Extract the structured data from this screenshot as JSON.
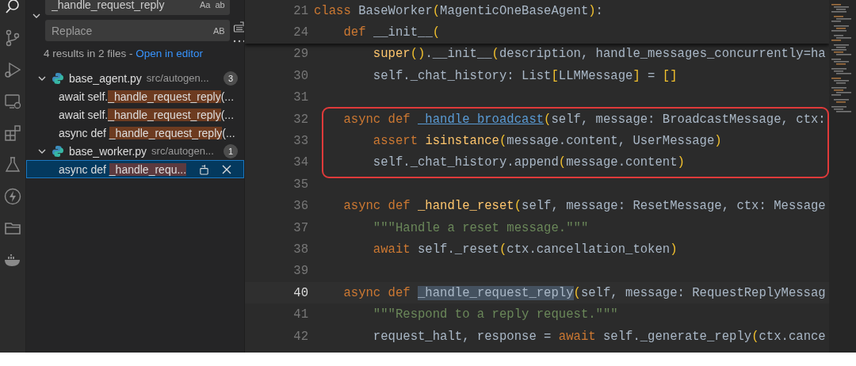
{
  "activity_bar": [
    {
      "kind": "search",
      "selected": true
    },
    {
      "kind": "source-control",
      "selected": false
    },
    {
      "kind": "run-debug",
      "selected": false
    },
    {
      "kind": "remote",
      "selected": false
    },
    {
      "kind": "extensions",
      "selected": false
    },
    {
      "kind": "testing",
      "selected": false
    },
    {
      "kind": "lightning",
      "selected": false
    },
    {
      "kind": "folder",
      "selected": false
    },
    {
      "kind": "docker",
      "selected": false
    }
  ],
  "search": {
    "find_value": "_handle_request_reply",
    "find_options": [
      "Aa",
      "ab"
    ],
    "replace_placeholder": "Replace",
    "replace_option": "AB",
    "summary": "4 results in 2 files - ",
    "open_link": "Open in editor",
    "files": [
      {
        "name": "base_agent.py",
        "path": "src/autogen...",
        "count": "3",
        "expanded": true,
        "matches": [
          {
            "before": "await self.",
            "match": "_handle_request_reply",
            "after": "(...",
            "selected": false
          },
          {
            "before": "await self.",
            "match": "_handle_request_reply",
            "after": "(...",
            "selected": false
          },
          {
            "before": "async def ",
            "match": "_handle_request_reply",
            "after": "(...",
            "selected": false
          }
        ]
      },
      {
        "name": "base_worker.py",
        "path": "src/autogen...",
        "count": "1",
        "expanded": true,
        "matches": [
          {
            "before": "async def ",
            "match": "_handle_requ...",
            "selected": true
          }
        ]
      }
    ]
  },
  "editor": {
    "sticky_lines": [
      {
        "number": "21",
        "tokens": [
          {
            "kind": "keyword",
            "text": "class "
          },
          {
            "kind": "plain",
            "text": "BaseWorker"
          },
          {
            "kind": "bracket",
            "text": "("
          },
          {
            "kind": "plain",
            "text": "MagenticOneBaseAgent"
          },
          {
            "kind": "bracket",
            "text": ")"
          },
          {
            "kind": "plain",
            "text": ":"
          }
        ]
      },
      {
        "number": "24",
        "tokens": [
          {
            "kind": "keyword",
            "text": "    def "
          },
          {
            "kind": "plain",
            "text": "__init__"
          },
          {
            "kind": "bracket",
            "text": "("
          }
        ]
      }
    ],
    "lines": [
      {
        "number": "29",
        "current": false,
        "boxed": false,
        "tokens": [
          {
            "kind": "function",
            "text": "        super"
          },
          {
            "kind": "bracket",
            "text": "()"
          },
          {
            "kind": "plain",
            "text": ".__init__"
          },
          {
            "kind": "bracket",
            "text": "("
          },
          {
            "kind": "plain",
            "text": "description, handle_messages_concurrently=ha"
          }
        ]
      },
      {
        "number": "30",
        "current": false,
        "boxed": false,
        "tokens": [
          {
            "kind": "plain",
            "text": "        self._chat_history: List"
          },
          {
            "kind": "bracket",
            "text": "["
          },
          {
            "kind": "plain",
            "text": "LLMMessage"
          },
          {
            "kind": "bracket",
            "text": "]"
          },
          {
            "kind": "plain",
            "text": " = "
          },
          {
            "kind": "bracket",
            "text": "[]"
          }
        ]
      },
      {
        "number": "31",
        "current": false,
        "boxed": false
      },
      {
        "number": "32",
        "current": false,
        "boxed": true,
        "tokens": [
          {
            "kind": "keyword",
            "text": "    async def "
          },
          {
            "kind": "link",
            "text": "_handle_broadcast"
          },
          {
            "kind": "bracket",
            "text": "("
          },
          {
            "kind": "plain",
            "text": "self, message: BroadcastMessage, ctx:"
          }
        ]
      },
      {
        "number": "33",
        "current": false,
        "boxed": true,
        "tokens": [
          {
            "kind": "keyword",
            "text": "        assert "
          },
          {
            "kind": "function",
            "text": "isinstance"
          },
          {
            "kind": "bracket",
            "text": "("
          },
          {
            "kind": "plain",
            "text": "message.content, UserMessage"
          },
          {
            "kind": "bracket",
            "text": ")"
          }
        ]
      },
      {
        "number": "34",
        "current": false,
        "boxed": true,
        "tokens": [
          {
            "kind": "plain",
            "text": "        self._chat_history.append"
          },
          {
            "kind": "bracket",
            "text": "("
          },
          {
            "kind": "plain",
            "text": "message.content"
          },
          {
            "kind": "bracket",
            "text": ")"
          }
        ]
      },
      {
        "number": "35",
        "current": false,
        "boxed": false
      },
      {
        "number": "36",
        "current": false,
        "boxed": false,
        "tokens": [
          {
            "kind": "keyword",
            "text": "    async def "
          },
          {
            "kind": "function",
            "text": "_handle_reset"
          },
          {
            "kind": "bracket",
            "text": "("
          },
          {
            "kind": "plain",
            "text": "self, message: ResetMessage, ctx: Message"
          }
        ]
      },
      {
        "number": "37",
        "current": false,
        "boxed": false,
        "tokens": [
          {
            "kind": "string",
            "text": "        \"\"\"Handle a reset message.\"\"\""
          }
        ]
      },
      {
        "number": "38",
        "current": false,
        "boxed": false,
        "tokens": [
          {
            "kind": "keyword",
            "text": "        await "
          },
          {
            "kind": "plain",
            "text": "self._reset"
          },
          {
            "kind": "bracket",
            "text": "("
          },
          {
            "kind": "plain",
            "text": "ctx.cancellation_token"
          },
          {
            "kind": "bracket",
            "text": ")"
          }
        ]
      },
      {
        "number": "39",
        "current": false,
        "boxed": false
      },
      {
        "number": "40",
        "current": true,
        "boxed": false,
        "tokens": [
          {
            "kind": "keyword",
            "text": "    async def "
          },
          {
            "kind": "selection",
            "text": "_handle_request_reply"
          },
          {
            "kind": "bracket",
            "text": "("
          },
          {
            "kind": "plain",
            "text": "self, message: RequestReplyMessag"
          }
        ]
      },
      {
        "number": "41",
        "current": false,
        "boxed": false,
        "tokens": [
          {
            "kind": "string",
            "text": "        \"\"\"Respond to a reply request.\"\"\""
          }
        ]
      },
      {
        "number": "42",
        "current": false,
        "boxed": false,
        "tokens": [
          {
            "kind": "plain",
            "text": "        request_halt, response = "
          },
          {
            "kind": "keyword",
            "text": "await "
          },
          {
            "kind": "plain",
            "text": "self._generate_reply"
          },
          {
            "kind": "bracket",
            "text": "("
          },
          {
            "kind": "plain",
            "text": "ctx.cance"
          }
        ]
      }
    ]
  }
}
